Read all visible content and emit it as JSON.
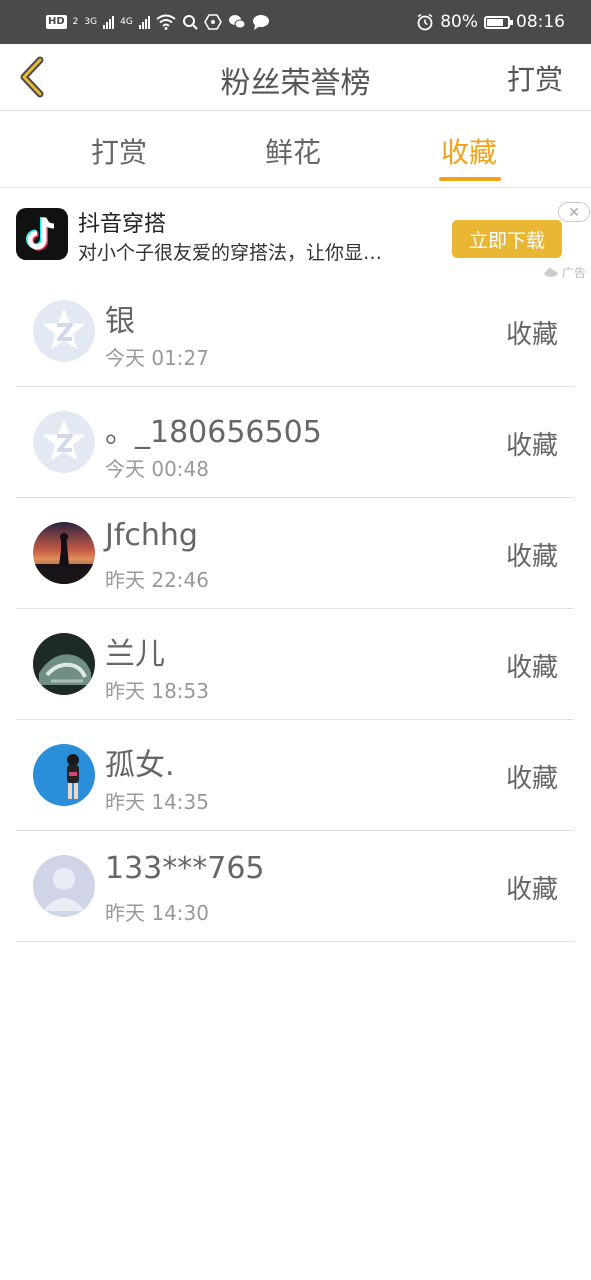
{
  "statusbar": {
    "hd": "HD",
    "hd_sub": "2",
    "net1": "3G",
    "net2": "4G",
    "battery_text": "80%",
    "battery_level": 0.8,
    "time": "08:16",
    "icons": [
      "wifi-icon",
      "search-icon",
      "hexagon-icon",
      "wechat-icon",
      "chat-bubble-icon",
      "alarm-icon",
      "battery-icon"
    ]
  },
  "header": {
    "title": "粉丝荣誉榜",
    "action": "打赏",
    "accent": "#f0a21a"
  },
  "tabs": [
    {
      "label": "打赏",
      "active": false
    },
    {
      "label": "鲜花",
      "active": false
    },
    {
      "label": "收藏",
      "active": true
    }
  ],
  "ad": {
    "app_name": "抖音穿搭",
    "description": "对小个子很友爱的穿搭法，让你显…",
    "button": "立即下载",
    "close": "✕",
    "label": "广告",
    "button_color": "#eab735"
  },
  "fans": [
    {
      "name": "银",
      "time": "今天 01:27",
      "action": "收藏",
      "avatar": "default-q-avatar"
    },
    {
      "name": "。_180656505",
      "time": "今天 00:48",
      "action": "收藏",
      "avatar": "default-q-avatar"
    },
    {
      "name": "Jfchhg",
      "time": "昨天 22:46",
      "action": "收藏",
      "avatar": "sunset-photo-avatar"
    },
    {
      "name": "兰儿",
      "time": "昨天 18:53",
      "action": "收藏",
      "avatar": "dark-photo-avatar"
    },
    {
      "name": "孤女.",
      "time": "昨天 14:35",
      "action": "收藏",
      "avatar": "blue-girl-avatar"
    },
    {
      "name": "133***765",
      "time": "昨天 14:30",
      "action": "收藏",
      "avatar": "default-person-avatar"
    }
  ]
}
